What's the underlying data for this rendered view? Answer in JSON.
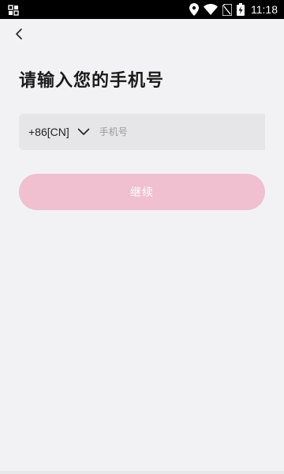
{
  "status_bar": {
    "time": "11:18",
    "icons": [
      "notification-icon",
      "location-icon",
      "wifi-icon",
      "no-sim-icon",
      "battery-charging-icon"
    ]
  },
  "header": {
    "back_icon": "chevron-left-icon",
    "title": "请输入您的手机号"
  },
  "phone_form": {
    "country_code": "+86[CN]",
    "phone_value": "",
    "phone_placeholder": "手机号",
    "continue_label": "继续"
  },
  "colors": {
    "background": "#f2f2f4",
    "input_background": "#e6e6e8",
    "button_disabled": "#f0bfd0",
    "title_text": "#1a1a1a"
  }
}
